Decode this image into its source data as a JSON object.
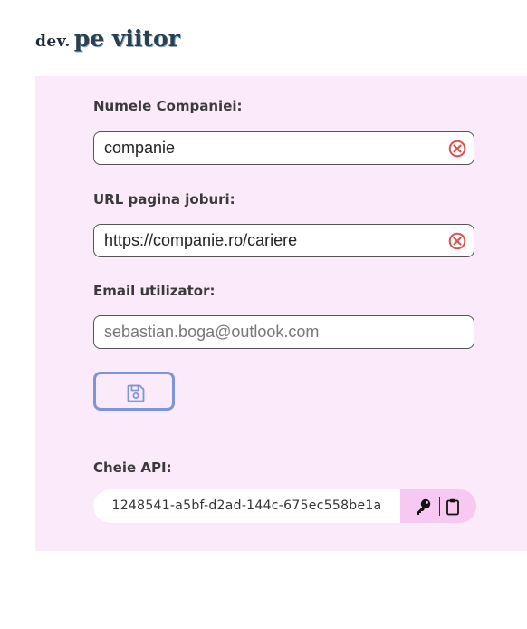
{
  "logo": {
    "prefix": "dev.",
    "name": "pe viitor"
  },
  "form": {
    "company": {
      "label": "Numele Companiei:",
      "value": "companie"
    },
    "jobs_url": {
      "label": "URL pagina joburi:",
      "value": "https://companie.ro/cariere"
    },
    "email": {
      "label": "Email utilizator:",
      "value": "sebastian.boga@outlook.com"
    },
    "save_icon": "floppy-disk-icon"
  },
  "api": {
    "label": "Cheie API:",
    "key": "1248541-a5bf-d2ad-144c-675ec558be1a",
    "generate_icon": "key-icon",
    "copy_icon": "clipboard-icon"
  },
  "colors": {
    "panel_bg": "#fbeaf9",
    "clear_icon": "#d9534f",
    "save_border": "#7b94dd",
    "api_actions_bg": "#f6c8f2"
  }
}
